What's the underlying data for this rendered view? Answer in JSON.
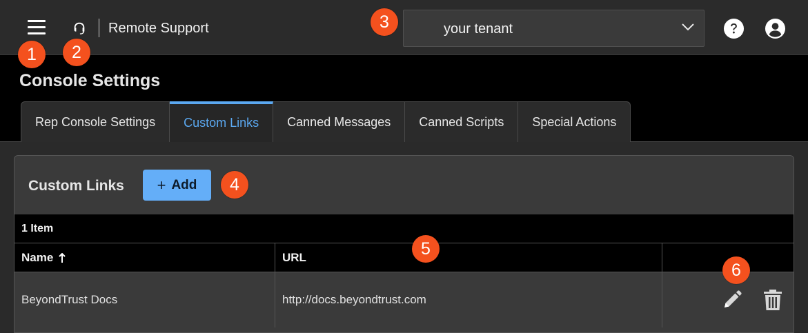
{
  "header": {
    "menu_icon": "hamburger-icon",
    "logo_icon": "headset-icon",
    "app_title": "Remote Support",
    "tenant_value": "your tenant",
    "tenant_chevron_icon": "chevron-down-icon",
    "help_icon": "help-circle-icon",
    "account_icon": "account-circle-icon"
  },
  "callouts": [
    "1",
    "2",
    "3",
    "4",
    "5",
    "6"
  ],
  "page": {
    "title": "Console Settings"
  },
  "tabs": [
    {
      "label": "Rep Console Settings",
      "active": false
    },
    {
      "label": "Custom Links",
      "active": true
    },
    {
      "label": "Canned Messages",
      "active": false
    },
    {
      "label": "Canned Scripts",
      "active": false
    },
    {
      "label": "Special Actions",
      "active": false
    }
  ],
  "panel": {
    "title": "Custom Links",
    "add_label": "Add",
    "add_plus": "+",
    "item_count": "1 Item"
  },
  "table": {
    "columns": [
      "Name",
      "URL",
      ""
    ],
    "sort_icon": "arrow-up-icon",
    "rows": [
      {
        "name": "BeyondTrust Docs",
        "url": "http://docs.beyondtrust.com",
        "edit_icon": "pencil-icon",
        "delete_icon": "trash-icon"
      }
    ]
  },
  "colors": {
    "accent": "#5ba8f0",
    "add_button": "#64aef8",
    "callout": "#f4511e",
    "topbar": "#2b2b2b",
    "panel": "#3a3a3a"
  }
}
